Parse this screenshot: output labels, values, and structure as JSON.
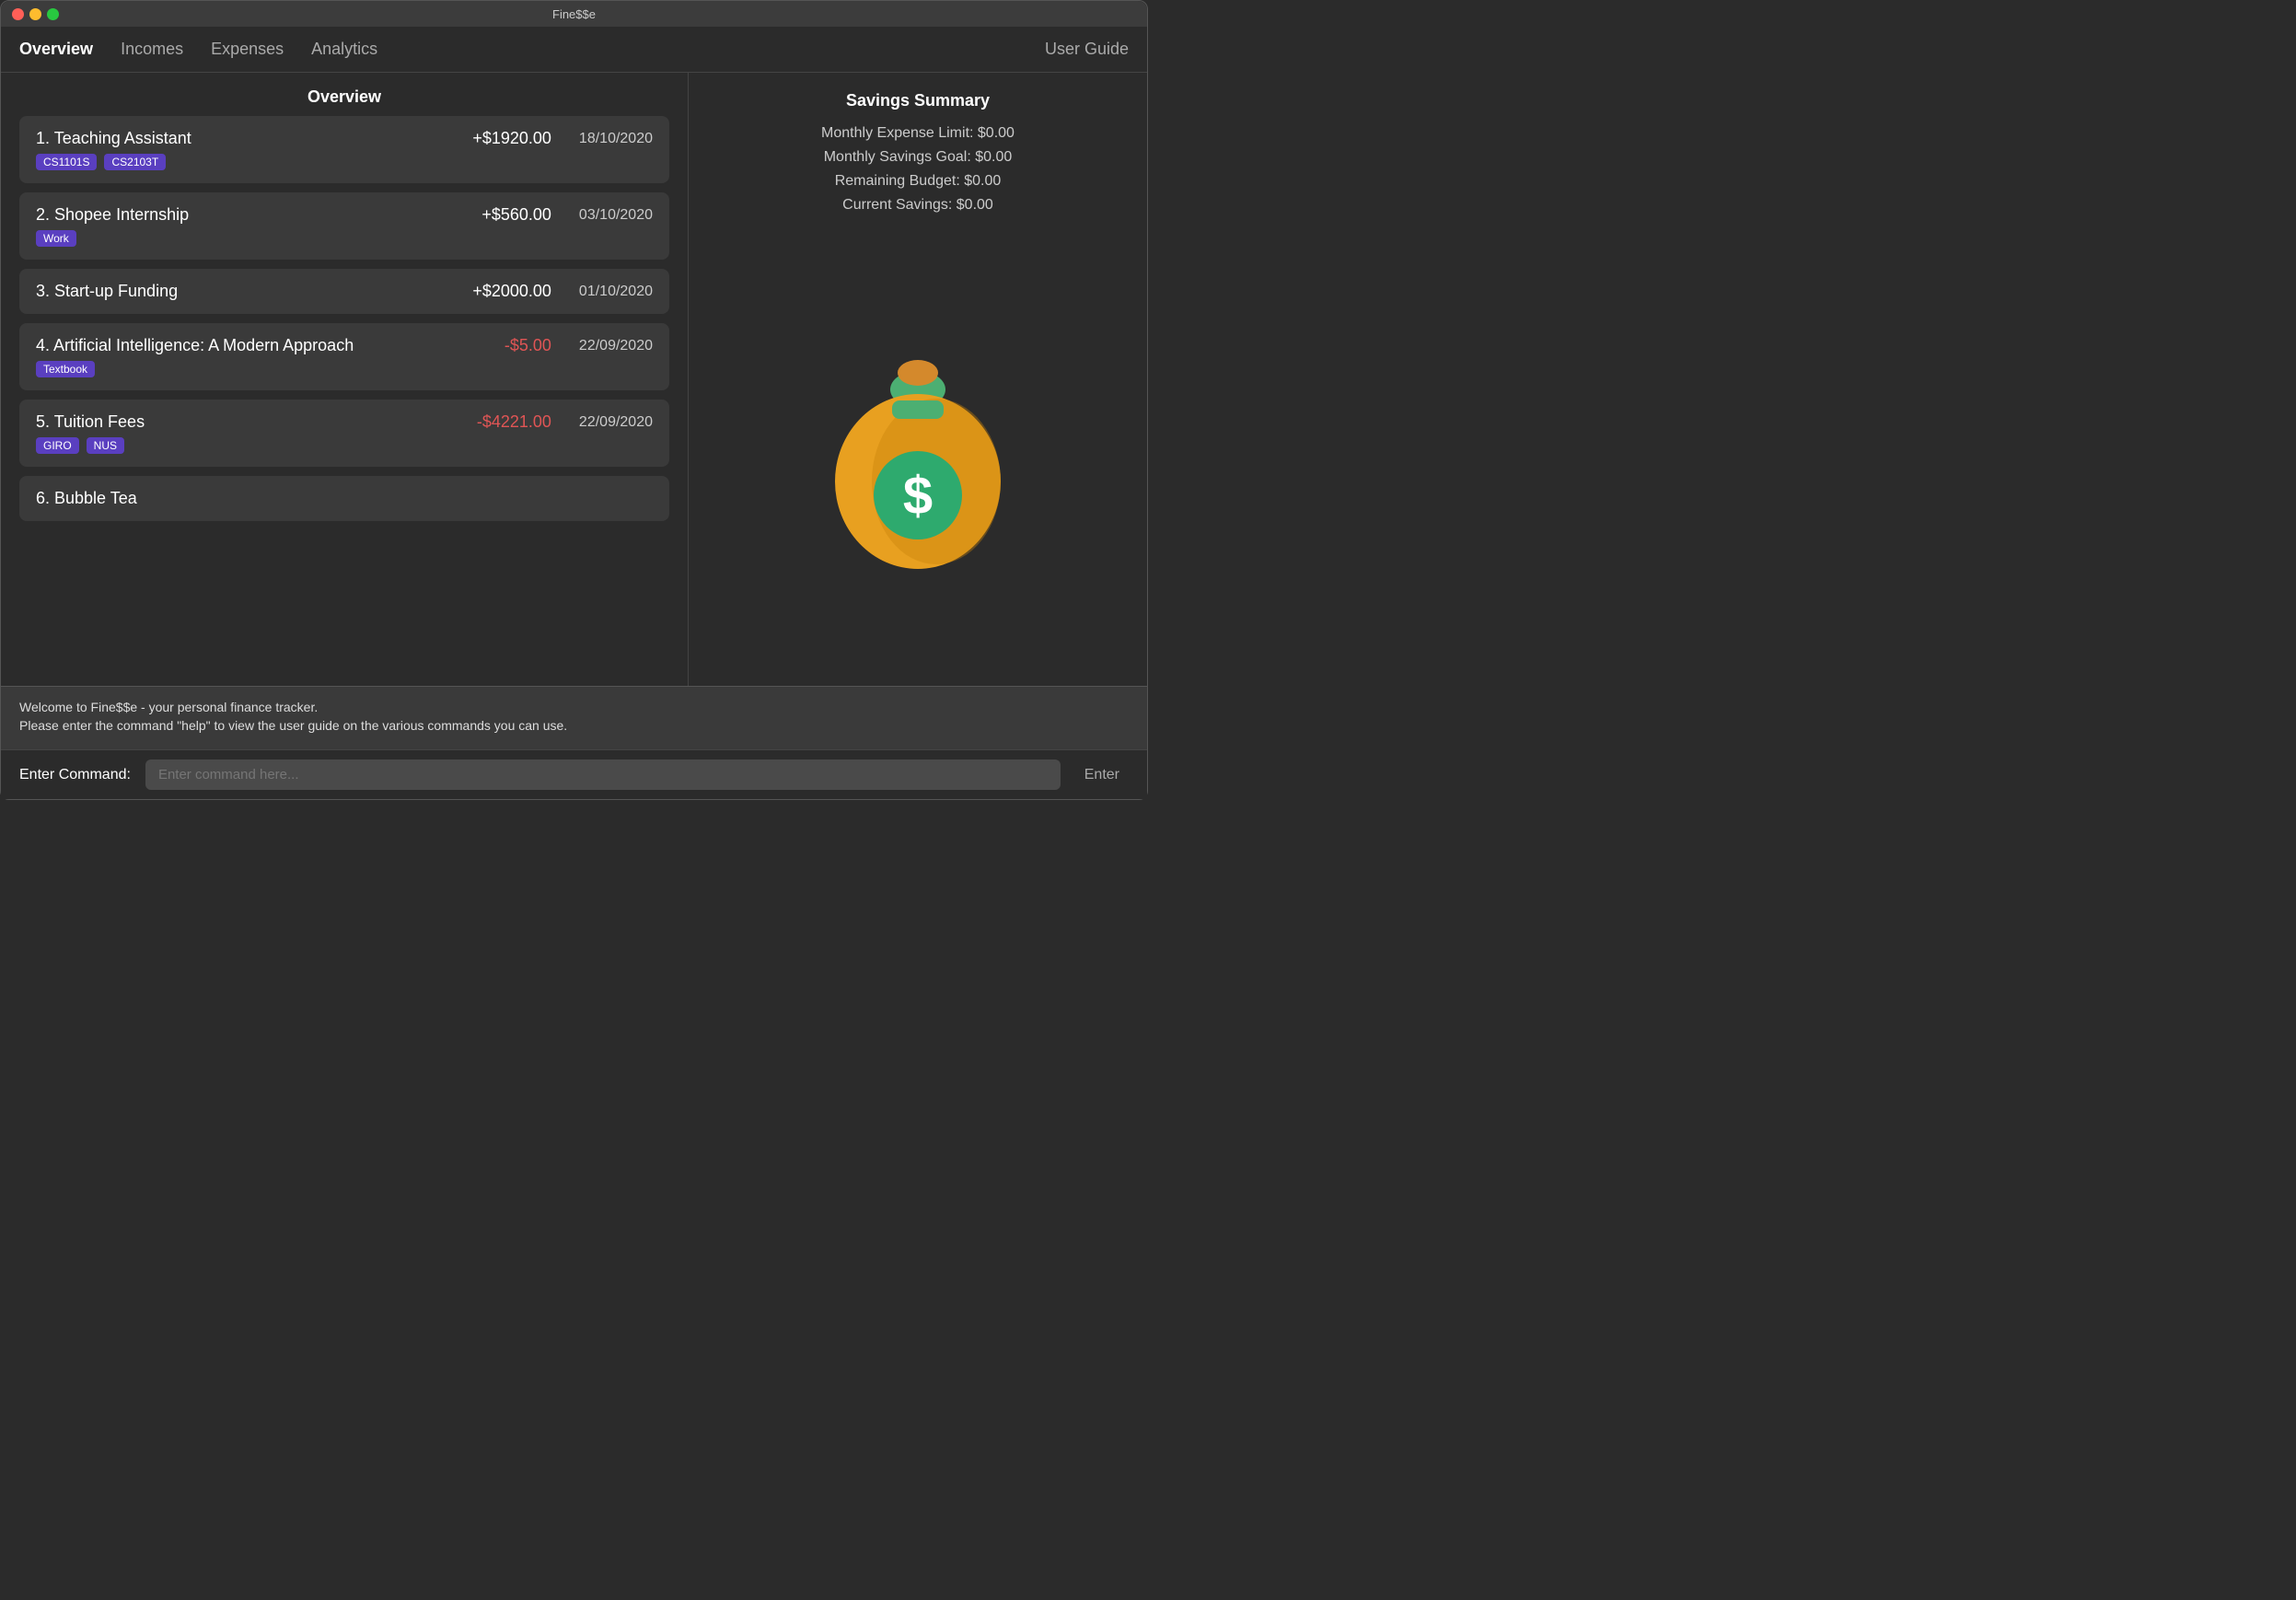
{
  "window": {
    "title": "Fine$$e"
  },
  "nav": {
    "links": [
      {
        "label": "Overview",
        "active": true
      },
      {
        "label": "Incomes",
        "active": false
      },
      {
        "label": "Expenses",
        "active": false
      },
      {
        "label": "Analytics",
        "active": false
      }
    ],
    "right": "User Guide"
  },
  "overview": {
    "header": "Overview"
  },
  "transactions": [
    {
      "index": 1,
      "name": "Teaching Assistant",
      "amount": "+$1920.00",
      "positive": true,
      "date": "18/10/2020",
      "tags": [
        "CS1101S",
        "CS2103T"
      ]
    },
    {
      "index": 2,
      "name": "Shopee Internship",
      "amount": "+$560.00",
      "positive": true,
      "date": "03/10/2020",
      "tags": [
        "Work"
      ]
    },
    {
      "index": 3,
      "name": "Start-up Funding",
      "amount": "+$2000.00",
      "positive": true,
      "date": "01/10/2020",
      "tags": []
    },
    {
      "index": 4,
      "name": "Artificial Intelligence: A Modern Approach",
      "amount": "-$5.00",
      "positive": false,
      "date": "22/09/2020",
      "tags": [
        "Textbook"
      ]
    },
    {
      "index": 5,
      "name": "Tuition Fees",
      "amount": "-$4221.00",
      "positive": false,
      "date": "22/09/2020",
      "tags": [
        "GIRO",
        "NUS"
      ]
    },
    {
      "index": 6,
      "name": "Bubble Tea",
      "amount": "",
      "positive": true,
      "date": "",
      "tags": []
    }
  ],
  "savings": {
    "title": "Savings Summary",
    "stats": [
      {
        "label": "Monthly Expense Limit: $0.00"
      },
      {
        "label": "Monthly Savings Goal: $0.00"
      },
      {
        "label": "Remaining Budget: $0.00"
      },
      {
        "label": "Current Savings: $0.00"
      }
    ]
  },
  "messages": [
    "Welcome to Fine$$e - your personal finance tracker.",
    "Please enter the command \"help\" to view the user guide on the various commands you can use."
  ],
  "command": {
    "label": "Enter Command:",
    "placeholder": "Enter command here...",
    "enter_label": "Enter"
  }
}
